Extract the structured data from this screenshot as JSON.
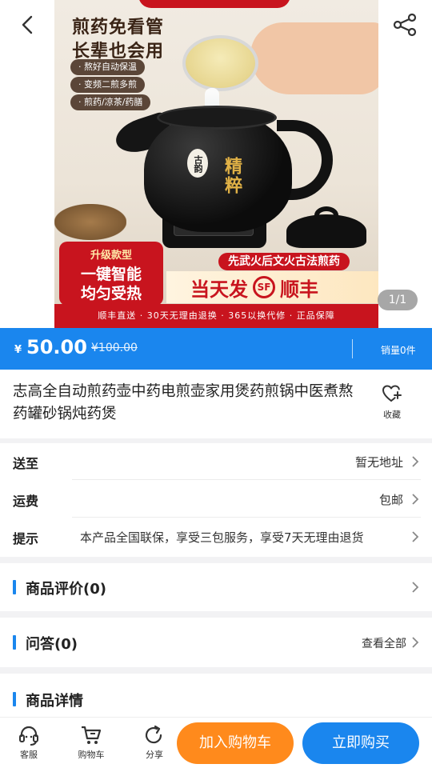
{
  "hero": {
    "image_counter": "1/1",
    "poster": {
      "headline_1": "煎药免看管",
      "headline_2": "长辈也会用",
      "features": [
        "· 熬好自动保温",
        "· 变频二煎多煎",
        "· 煎药/凉茶/药膳"
      ],
      "seal_text": "古韵",
      "gold_text": "精粹",
      "upgrade": "升级款型",
      "smart_1": "一键智能",
      "smart_2": "均匀受热",
      "slogan": "先武火后文火古法煎药",
      "sameday": "当天发",
      "sf_logo": "SF",
      "sf_text": "顺丰",
      "footer": "顺丰直送 · 30天无理由退换 · 365以换代修 · 正品保障"
    }
  },
  "price": {
    "currency": "¥",
    "current": "50.00",
    "original": "¥100.00",
    "sales": "销量0件"
  },
  "product": {
    "title": "志高全自动煎药壶中药电煎壶家用煲药煎锅中医煮熬药罐砂锅炖药煲",
    "favorite_label": "收藏"
  },
  "info": {
    "ship_to_label": "送至",
    "ship_to_value": "暂无地址",
    "freight_label": "运费",
    "freight_value": "包邮",
    "notice_label": "提示",
    "notice_value": "本产品全国联保，享受三包服务，享受7天无理由退货"
  },
  "sections": {
    "reviews": "商品评价(0)",
    "qa": "问答(0)",
    "qa_more": "查看全部",
    "details": "商品详情"
  },
  "bottom_bar": {
    "service": "客服",
    "cart": "购物车",
    "share": "分享",
    "add_to_cart": "加入购物车",
    "buy_now": "立即购买"
  },
  "colors": {
    "primary_blue": "#1a86ee",
    "orange": "#ff8a1c",
    "poster_red": "#c8141e"
  }
}
